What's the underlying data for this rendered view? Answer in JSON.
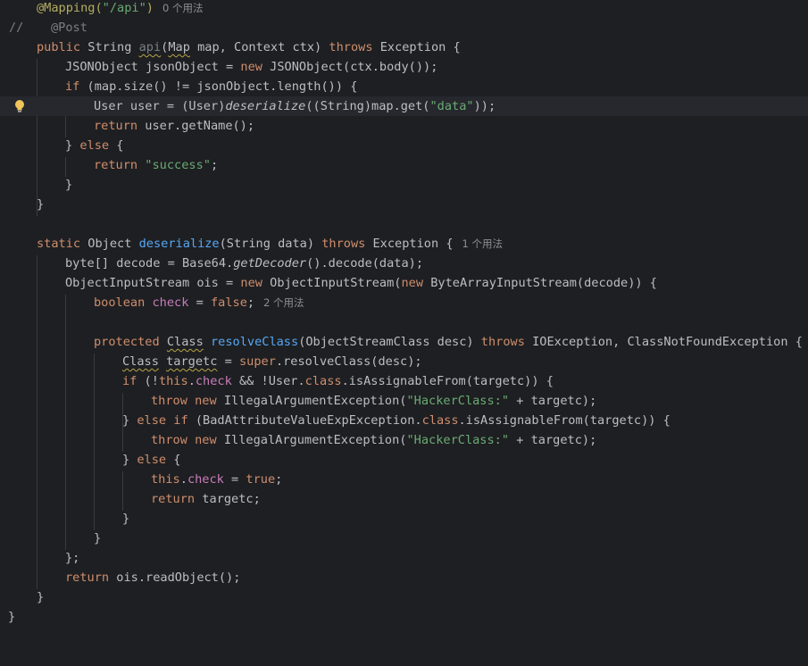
{
  "editor": {
    "theme_colors": {
      "background": "#1e1f22",
      "keyword": "#cf8e6d",
      "string": "#6aab73",
      "annotation": "#b3ae60",
      "method_declaration": "#56a8f5",
      "field": "#c77dbb",
      "default_text": "#bcbec4",
      "comment": "#7a7e85"
    },
    "usage_hints": {
      "api": "0 个用法",
      "deserialize": "1 个用法",
      "check": "2 个用法"
    },
    "gutter": {
      "comment_marker": "//",
      "intention_icon": "lightbulb-icon"
    },
    "lines": {
      "l1": {
        "annotation": "@Mapping(",
        "string": "\"/api\"",
        "close": ")"
      },
      "l2": {
        "annotation": "@Post"
      },
      "l3": {
        "kw1": "public",
        "t1": " String ",
        "squig": "api",
        "t2": "(",
        "squig2": "Map",
        "t3": " map, Context ctx) ",
        "kw2": "throws",
        "t4": " Exception {"
      },
      "l4": {
        "t1": "JSONObject jsonObject = ",
        "kw1": "new",
        "t2": " JSONObject(ctx.body());"
      },
      "l5": {
        "kw1": "if",
        "t1": " (map.size() != jsonObject.length()) {"
      },
      "l6": {
        "t1": "User user = (User)",
        "it": "deserialize",
        "t2": "((String)map.get(",
        "str": "\"data\"",
        "t3": "));"
      },
      "l7": {
        "kw1": "return",
        "t1": " user.getName();"
      },
      "l8": {
        "t1": "} ",
        "kw1": "else",
        "t2": " {"
      },
      "l9": {
        "kw1": "return",
        "t1": " ",
        "str": "\"success\"",
        "t2": ";"
      },
      "l10": {
        "t1": "}"
      },
      "l11": {
        "t1": "}"
      },
      "l13": {
        "kw1": "static",
        "t1": " Object ",
        "fn": "deserialize",
        "t2": "(String data) ",
        "kw2": "throws",
        "t3": " Exception {"
      },
      "l14": {
        "t1": "byte[] decode = Base64.",
        "it": "getDecoder",
        "t2": "().decode(data);"
      },
      "l15": {
        "t1": "ObjectInputStream ois = ",
        "kw1": "new",
        "t2": " ObjectInputStream(",
        "kw2": "new",
        "t3": " ByteArrayInputStream(decode)) {"
      },
      "l16": {
        "kw1": "boolean",
        "t1": " ",
        "field": "check",
        "t2": " = ",
        "kw2": "false",
        "t3": ";"
      },
      "l18": {
        "kw1": "protected",
        "t1": " ",
        "squig": "Class",
        "t2": " ",
        "fn": "resolveClass",
        "t3": "(ObjectStreamClass desc) ",
        "kw2": "throws",
        "t4": " IOException, ClassNotFoundException {"
      },
      "l19": {
        "squig": "Class",
        "t1": " ",
        "squig2": "targetc",
        "t2": " = ",
        "kw1": "super",
        "t3": ".resolveClass(desc);"
      },
      "l20": {
        "kw1": "if",
        "t1": " (!",
        "kw2": "this",
        "t2": ".",
        "field": "check",
        "t3": " && !User.",
        "kw3": "class",
        "t4": ".isAssignableFrom(targetc)) {"
      },
      "l21": {
        "kw1": "throw",
        "t1": " ",
        "kw2": "new",
        "t2": " IllegalArgumentException(",
        "str": "\"HackerClass:\"",
        "t3": " + targetc);"
      },
      "l22": {
        "t1": "} ",
        "kw1": "else if",
        "t2": " (BadAttributeValueExpException.",
        "kw2": "class",
        "t3": ".isAssignableFrom(targetc)) {"
      },
      "l23": {
        "kw1": "throw",
        "t1": " ",
        "kw2": "new",
        "t2": " IllegalArgumentException(",
        "str": "\"HackerClass:\"",
        "t3": " + targetc);"
      },
      "l24": {
        "t1": "} ",
        "kw1": "else",
        "t2": " {"
      },
      "l25": {
        "kw1": "this",
        "t1": ".",
        "field": "check",
        "t2": " = ",
        "kw2": "true",
        "t3": ";"
      },
      "l26": {
        "kw1": "return",
        "t1": " targetc;"
      },
      "l27": {
        "t1": "}"
      },
      "l28": {
        "t1": "}"
      },
      "l29": {
        "t1": "};"
      },
      "l30": {
        "kw1": "return",
        "t1": " ois.readObject();"
      },
      "l31": {
        "t1": "}"
      },
      "l32": {
        "t1": "}"
      }
    }
  }
}
